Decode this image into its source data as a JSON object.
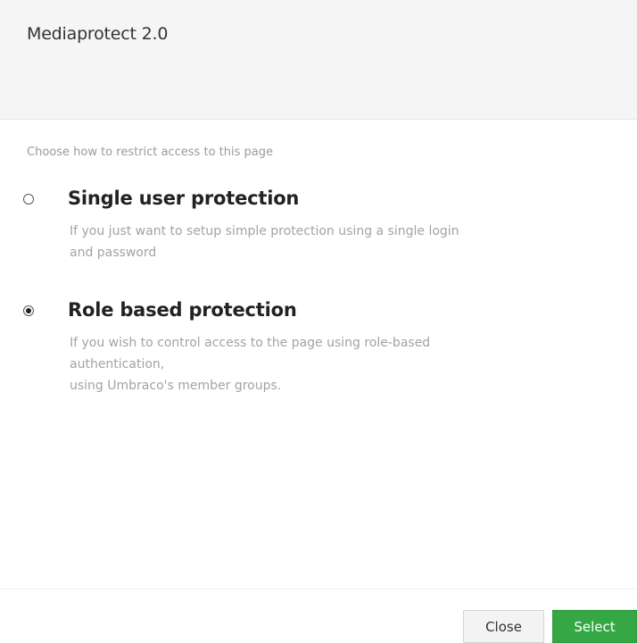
{
  "header": {
    "title": "Mediaprotect 2.0"
  },
  "intro": "Choose how to restrict access to this page",
  "options": [
    {
      "title": "Single user protection",
      "description_lines": [
        "If you just want to setup simple protection using a single login",
        "and password"
      ],
      "selected": false
    },
    {
      "title": "Role based protection",
      "description_lines": [
        "If you wish to control access to the page using role-based",
        "authentication,",
        "using Umbraco's member groups."
      ],
      "selected": true
    }
  ],
  "footer": {
    "close_label": "Close",
    "select_label": "Select"
  },
  "colors": {
    "header_bg": "#f5f5f5",
    "select_button": "#35a845",
    "description_text": "#a3a3a3"
  }
}
